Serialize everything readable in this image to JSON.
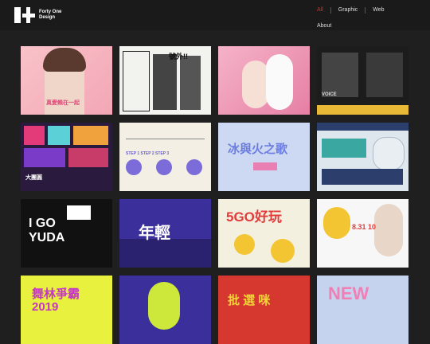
{
  "brand": {
    "name_line1": "Forty One",
    "name_line2": "Design"
  },
  "nav": {
    "items": [
      "All",
      "Graphic",
      "Web"
    ],
    "second_row": "About"
  },
  "tiles": [
    {
      "text": "真愛賴在一起"
    },
    {
      "text": "號外!!"
    },
    {
      "text": ""
    },
    {
      "text": "VOICE"
    },
    {
      "text": "大團圓"
    },
    {
      "text": "STEP 1 STEP 2 STEP 3"
    },
    {
      "text": "冰與火之歌"
    },
    {
      "text": ""
    },
    {
      "text": "I GO YUDA"
    },
    {
      "text": "年輕"
    },
    {
      "text": "5GO好玩"
    },
    {
      "text": "8.31 10"
    },
    {
      "text": "舞林爭霸 2019"
    },
    {
      "text": ""
    },
    {
      "text": "批 選 咪"
    },
    {
      "text": "NEW"
    }
  ]
}
